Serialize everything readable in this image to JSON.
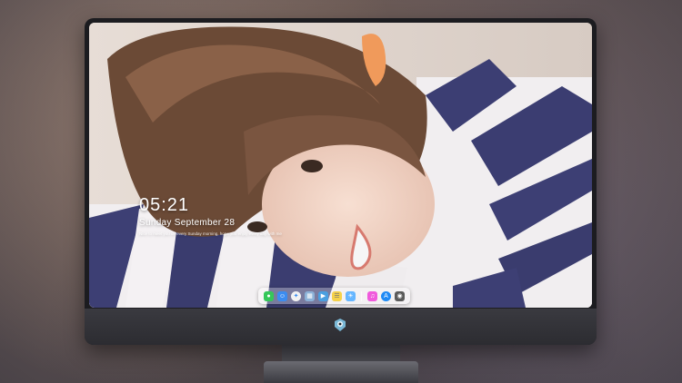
{
  "clock": {
    "time": "05:21",
    "date": "Sunday September  28",
    "message": "Nice to meet you on every Sunday morning, hope you enjoy every day with me"
  },
  "dock": {
    "items": [
      {
        "name": "messages-icon",
        "color": "#35c759"
      },
      {
        "name": "finder-icon",
        "color": "#3b8cf0"
      },
      {
        "name": "safari-icon",
        "color": "#f2f2f2"
      },
      {
        "name": "preview-icon",
        "color": "#8cb2d8"
      },
      {
        "name": "clapper-icon",
        "color": "#4a9fe0"
      },
      {
        "name": "notes-icon",
        "color": "#f6d24a"
      },
      {
        "name": "photos-icon",
        "color": "#66b6ff"
      },
      {
        "name": "separator",
        "color": ""
      },
      {
        "name": "music-icon",
        "color": "#f05adc"
      },
      {
        "name": "app-store-icon",
        "color": "#1e8af5"
      },
      {
        "name": "camera-icon",
        "color": "#5b5b5b"
      }
    ]
  }
}
